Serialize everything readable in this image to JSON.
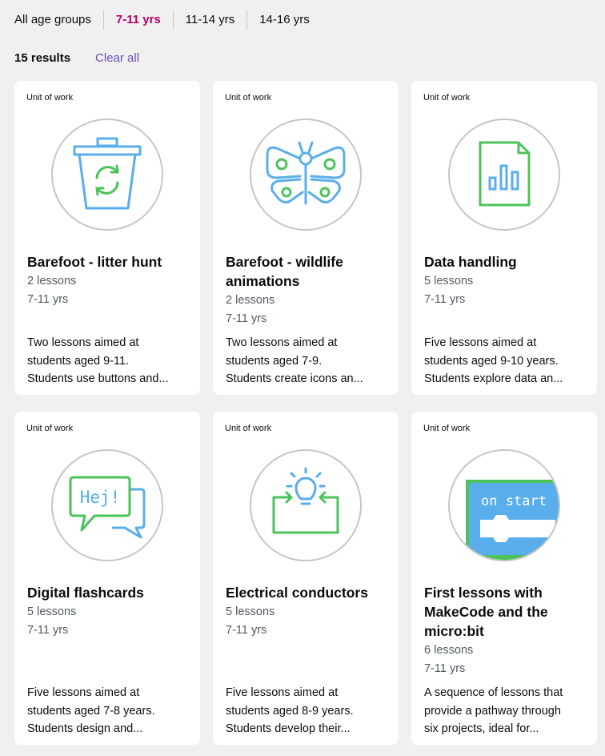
{
  "age_filters": [
    {
      "label": "All age groups",
      "active": false
    },
    {
      "label": "7-11 yrs",
      "active": true
    },
    {
      "label": "11-14 yrs",
      "active": false
    },
    {
      "label": "14-16 yrs",
      "active": false
    }
  ],
  "results": {
    "count_label": "15 results",
    "clear_label": "Clear all"
  },
  "colors": {
    "accent": "#b5006c",
    "link": "#6b4fbb",
    "icon_blue": "#5aaeec",
    "icon_green": "#4cc35a"
  },
  "cards": [
    {
      "tag": "Unit of work",
      "icon": "recycle-bin-icon",
      "title": "Barefoot - litter hunt",
      "lessons": "2 lessons",
      "age": "7-11 yrs",
      "desc": [
        "Two lessons aimed at",
        "students aged 9-11.",
        "Students use buttons and..."
      ]
    },
    {
      "tag": "Unit of work",
      "icon": "butterfly-icon",
      "title_lines": [
        "Barefoot - wildlife",
        "animations"
      ],
      "lessons": "2 lessons",
      "age": "7-11 yrs",
      "desc": [
        "Two lessons aimed at",
        "students aged 7-9.",
        "Students create icons an..."
      ]
    },
    {
      "tag": "Unit of work",
      "icon": "bar-chart-document-icon",
      "title": "Data handling",
      "lessons": "5 lessons",
      "age": "7-11 yrs",
      "desc": [
        "Five lessons aimed at",
        "students aged 9-10 years.",
        "Students explore data an..."
      ]
    },
    {
      "tag": "Unit of work",
      "icon": "speech-bubbles-icon",
      "icon_text": "Hej!",
      "title": "Digital flashcards",
      "lessons": "5 lessons",
      "age": "7-11 yrs",
      "desc": [
        "Five lessons aimed at",
        "students aged 7-8 years.",
        "Students design and..."
      ]
    },
    {
      "tag": "Unit of work",
      "icon": "lightbulb-circuit-icon",
      "title": "Electrical conductors",
      "lessons": "5 lessons",
      "age": "7-11 yrs",
      "desc": [
        "Five lessons aimed at",
        "students aged 8-9 years.",
        "Students develop their..."
      ]
    },
    {
      "tag": "Unit of work",
      "icon": "makecode-block-icon",
      "icon_text": "on start",
      "title_lines": [
        "First lessons with",
        "MakeCode and the",
        "micro:bit"
      ],
      "lessons": "6 lessons",
      "age": "7-11 yrs",
      "desc": [
        "A sequence of lessons that",
        "provide a pathway through",
        "six projects, ideal for..."
      ]
    }
  ]
}
